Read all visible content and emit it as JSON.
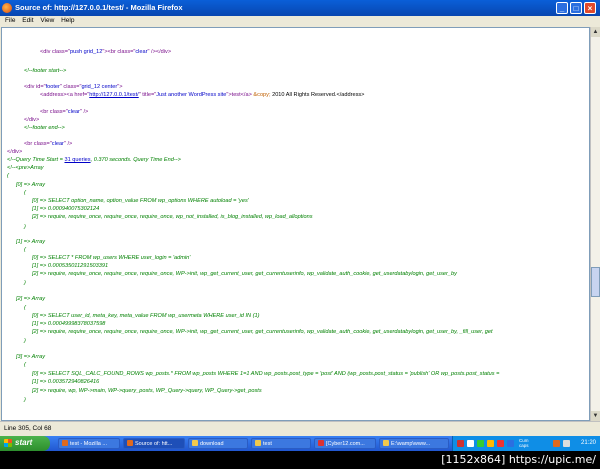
{
  "window": {
    "title": "Source of: http://127.0.0.1/test/ - Mozilla Firefox"
  },
  "menu": [
    "File",
    "Edit",
    "View",
    "Help"
  ],
  "source": {
    "l1": {
      "a": "<div class=\"",
      "b": "push grid_12",
      "c": "\"><br class=\"",
      "d": "clear",
      "e": "\" /></div>"
    },
    "l2": "<!--footer start-->",
    "l3": {
      "a": "<div id=\"",
      "b": "footer",
      "c": "\" class=\"",
      "d": "grid_12 center",
      "e": "\">"
    },
    "l4": {
      "a": "<address><a href=\"",
      "link": "http://127.0.0.1/test/",
      "c": "\" title=\"",
      "d": "Just another WordPress site",
      "e": "\">test</a> ",
      "ent": "&copy;",
      "f": " 2010  All Rights Reserved.</address>"
    },
    "l5": {
      "a": "<br class=\"",
      "b": "clear",
      "c": "\" />"
    },
    "l6": "</div>",
    "l7": "<!--footer end-->",
    "l8": {
      "a": "<br class=\"",
      "b": "clear",
      "c": "\" />"
    },
    "l9": "</div>",
    "l10": {
      "a": "<!--Query Time Start = ",
      "link": "31 queries",
      "b": ", 0.370 seconds. Query Time End-->"
    },
    "l11": "<!--<pre>Array",
    "l12": "(",
    "q0": {
      "head": "[0] => Array",
      "open": "(",
      "r0": "[0] => SELECT option_name, option_value FROM wp_options WHERE autoload = 'yes'",
      "r1": "[1] => 0.000940075302124",
      "r2": "[2] => require, require_once, require_once, require_once, wp_not_installed, is_blog_installed, wp_load_alloptions",
      "close": ")"
    },
    "q1": {
      "head": "[1] => Array",
      "open": "(",
      "r0": "[0] => SELECT * FROM wp_users WHERE user_login = 'admin'",
      "r1": "[1] => 0.000535011291503391",
      "r2": "[2] => require, require_once, require_once, require_once, WP->init, wp_get_current_user, get_currentuserinfo, wp_validate_auth_cookie, get_userdatabylogin, get_user_by",
      "close": ")"
    },
    "q2": {
      "head": "[2] => Array",
      "open": "(",
      "r0": "[0] => SELECT user_id, meta_key, meta_value FROM wp_usermeta WHERE user_id IN (1)",
      "r1": "[1] => 0.00049998378037598",
      "r2": "[2] => require, require_once, require_once, require_once, WP->init, wp_get_current_user, get_currentuserinfo, wp_validate_auth_cookie, get_userdatabylogin, get_user_by, _fill_user, get",
      "close": ")"
    },
    "q3": {
      "head": "[3] => Array",
      "open": "(",
      "r0": "[0] => SELECT SQL_CALC_FOUND_ROWS  wp_posts.* FROM wp_posts  WHERE 1=1  AND wp_posts.post_type = 'post' AND (wp_posts.post_status = 'publish' OR wp_posts.post_status =",
      "r1": "[1] => 0.003572940826416",
      "r2": "[2] => require, wp, WP->main, WP->query_posts, WP_Query->query, WP_Query->get_posts",
      "close": ")"
    }
  },
  "status": "Line 305, Col 68",
  "taskbar": {
    "start": "start",
    "tasks": [
      "test - Mozilla ...",
      "Source of: htt...",
      "download",
      "test",
      "[Cyber12.com...",
      "E:\\wamp\\www..."
    ],
    "lang_line1": "Cum",
    "lang_line2": "caps",
    "clock": "21:20"
  },
  "watermark": "[1152x864] https://upic.me/",
  "colors": {
    "titlebar": "#0846b0",
    "taskbar": "#2157d0",
    "start": "#2d8e2d",
    "tag": "#7a0f8b",
    "value": "#0000c8",
    "comment": "#008000"
  }
}
